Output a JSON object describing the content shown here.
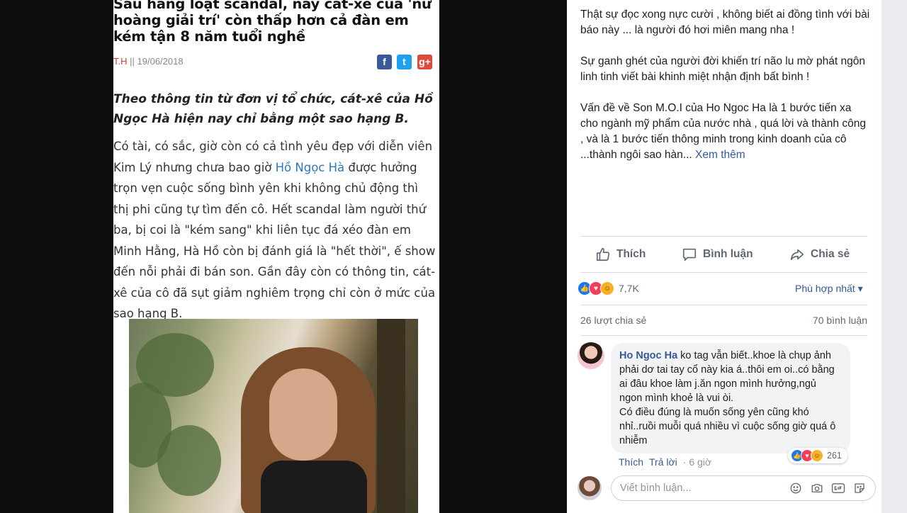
{
  "article": {
    "title": "Sau hàng loạt scandal, nay cát-xê của 'nữ hoàng giải trí' còn thấp hơn cả đàn em kém tận 8 năm tuổi nghề",
    "author": "T.H",
    "separator": "||",
    "date": "19/06/2018",
    "share": {
      "facebook": "f",
      "twitter": "t",
      "google": "g+"
    },
    "lead": "Theo thông tin từ đơn vị tổ chức, cát-xê của Hồ Ngọc Hà hiện nay chỉ bằng một sao hạng B.",
    "body_before_link": "Có tài, có sắc, giờ còn có cả tình yêu đẹp với diễn viên Kim Lý nhưng chưa bao giờ ",
    "body_link": "Hồ Ngọc Hà",
    "body_after_link": " được hưởng trọn vẹn cuộc sống bình yên khi không chủ động thì thị phi cũng tự tìm đến cô. Hết scandal làm người thứ ba, bị coi là \"kém sang\" khi liên tục đá xéo đàn em Minh Hằng, Hà Hồ còn bị đánh giá là \"hết thời\", ế show đến nỗi phải đi bán son. Gần đây còn có thông tin, cát-xê của cô đã sụt giảm nghiêm trọng chỉ còn ở mức của sao hạng B."
  },
  "post": {
    "paragraphs": [
      "Thật sự đọc xong nực cười , không biết ai đồng tình với bài báo này ... là người đó hơi miên mang nha !",
      "Sự ganh ghét của người đời khiến trí não lu mờ phát ngôn linh tinh viết bài khinh miệt nhận định bất bình !"
    ],
    "last_paragraph": "Vấn đề về Son M.O.I của Ho Ngoc Ha là 1 bước tiến xa cho ngành mỹ phẩm của nước nhà , quá lời và thành công , và là 1 bước tiến thông minh trong kinh doanh của cô ...thành ngôi sao hàn...",
    "see_more": "Xem thêm"
  },
  "actions": {
    "like": "Thích",
    "comment": "Bình luận",
    "share": "Chia sẻ"
  },
  "reactions": {
    "count": "7,7K",
    "sort_label": "Phù hợp nhất ▾"
  },
  "stats": {
    "shares": "26 lượt chia sẻ",
    "comments": "70 bình luận"
  },
  "comment": {
    "author": "Ho Ngoc Ha",
    "text": "ko tag vẫn biết..khoe là chụp ảnh phải dơ tai tay cổ này kia á..thôi em oi..có bằng ai đâu khoe làm j.ăn ngon mình hưởng,ngủ ngon mình khoẻ là vui òi.",
    "text2": "Có điều đúng là muốn sống yên cũng khó nhỉ..ruồi muỗi quá nhiều vì cuộc sống giờ quá ô nhiễm",
    "reaction_count": "261",
    "like": "Thích",
    "reply": "Trả lời",
    "time": "· 6 giờ"
  },
  "composer": {
    "placeholder": "Viết bình luận..."
  },
  "colors": {
    "facebook_blue": "#385898",
    "like_blue": "#1877f2",
    "love_red": "#f33e58",
    "haha_yellow": "#f7b125",
    "author_red": "#d93a2b"
  }
}
